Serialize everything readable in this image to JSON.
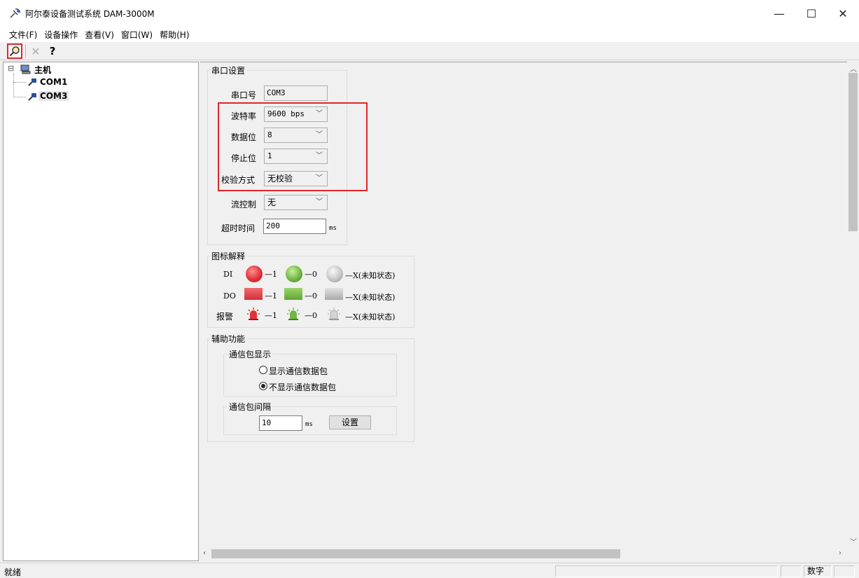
{
  "window": {
    "title": "阿尔泰设备测试系统 DAM-3000M",
    "minimize": "—",
    "maximize": "☐",
    "close": "✕"
  },
  "menu": [
    "文件(F)",
    "设备操作",
    "查看(V)",
    "窗口(W)",
    "帮助(H)"
  ],
  "toolbar": {
    "search_icon": "search-icon",
    "delete_glyph": "✕",
    "help_glyph": "?"
  },
  "tree": {
    "root": "主机",
    "expander": "⊟",
    "children": [
      "COM1",
      "COM3"
    ]
  },
  "serial": {
    "group_title": "串口设置",
    "port_label": "串口号",
    "port_value": "COM3",
    "baud_label": "波特率",
    "baud_value": "9600 bps",
    "databits_label": "数据位",
    "databits_value": "8",
    "stopbits_label": "停止位",
    "stopbits_value": "1",
    "parity_label": "校验方式",
    "parity_value": "无校验",
    "flow_label": "流控制",
    "flow_value": "无",
    "timeout_label": "超时时间",
    "timeout_value": "200",
    "timeout_unit": "ms"
  },
  "legend": {
    "group_title": "图标解释",
    "di_label": "DI",
    "do_label": "DO",
    "alarm_label": "报警",
    "one": "—1",
    "zero": "—0",
    "unknown": "—X(未知状态)",
    "colors": {
      "red": "#e0323a",
      "green": "#72b743",
      "gray": "#c6c6c6"
    }
  },
  "aux": {
    "group_title": "辅助功能",
    "packet_display_title": "通信包显示",
    "show_packets": "显示通信数据包",
    "hide_packets": "不显示通信数据包",
    "interval_title": "通信包间隔",
    "interval_value": "10",
    "interval_unit": "ms",
    "set_button": "设置"
  },
  "status": {
    "ready": "就绪",
    "numlock": "数字"
  }
}
